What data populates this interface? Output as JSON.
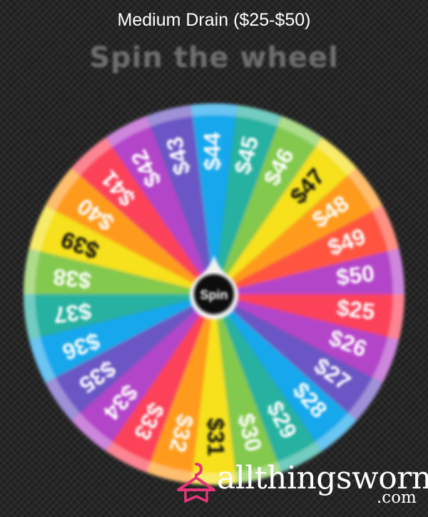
{
  "header": {
    "title": "Medium Drain ($25-$50)"
  },
  "subtitle": "Spin the wheel",
  "wheel": {
    "center_label": "Spin",
    "segments": [
      {
        "label": "$44",
        "color": "#19a7ec"
      },
      {
        "label": "$45",
        "color": "#27b1a0"
      },
      {
        "label": "$46",
        "color": "#82c94e"
      },
      {
        "label": "$47",
        "color": "#f6e11c"
      },
      {
        "label": "$48",
        "color": "#ff9b1f"
      },
      {
        "label": "$49",
        "color": "#ff5440"
      },
      {
        "label": "$50",
        "color": "#b345c9"
      },
      {
        "label": "$25",
        "color": "#fb4358"
      },
      {
        "label": "$26",
        "color": "#b345c9"
      },
      {
        "label": "$27",
        "color": "#6b56c4"
      },
      {
        "label": "$28",
        "color": "#19a7ec"
      },
      {
        "label": "$29",
        "color": "#27b1a0"
      },
      {
        "label": "$30",
        "color": "#82c94e"
      },
      {
        "label": "$31",
        "color": "#f6e11c"
      },
      {
        "label": "$32",
        "color": "#ff9b1f"
      },
      {
        "label": "$33",
        "color": "#fb4358"
      },
      {
        "label": "$34",
        "color": "#b345c9"
      },
      {
        "label": "$35",
        "color": "#6b56c4"
      },
      {
        "label": "$36",
        "color": "#19a7ec"
      },
      {
        "label": "$37",
        "color": "#27b1a0"
      },
      {
        "label": "$38",
        "color": "#82c94e"
      },
      {
        "label": "$39",
        "color": "#f6e11c"
      },
      {
        "label": "$40",
        "color": "#ff9b1f"
      },
      {
        "label": "$41",
        "color": "#fb4358"
      },
      {
        "label": "$42",
        "color": "#b345c9"
      },
      {
        "label": "$43",
        "color": "#6b56c4"
      }
    ]
  },
  "brand": {
    "name": "allthingsworn",
    "domain": ".com",
    "icon": "hanger-icon",
    "accent": "#e8357a"
  }
}
